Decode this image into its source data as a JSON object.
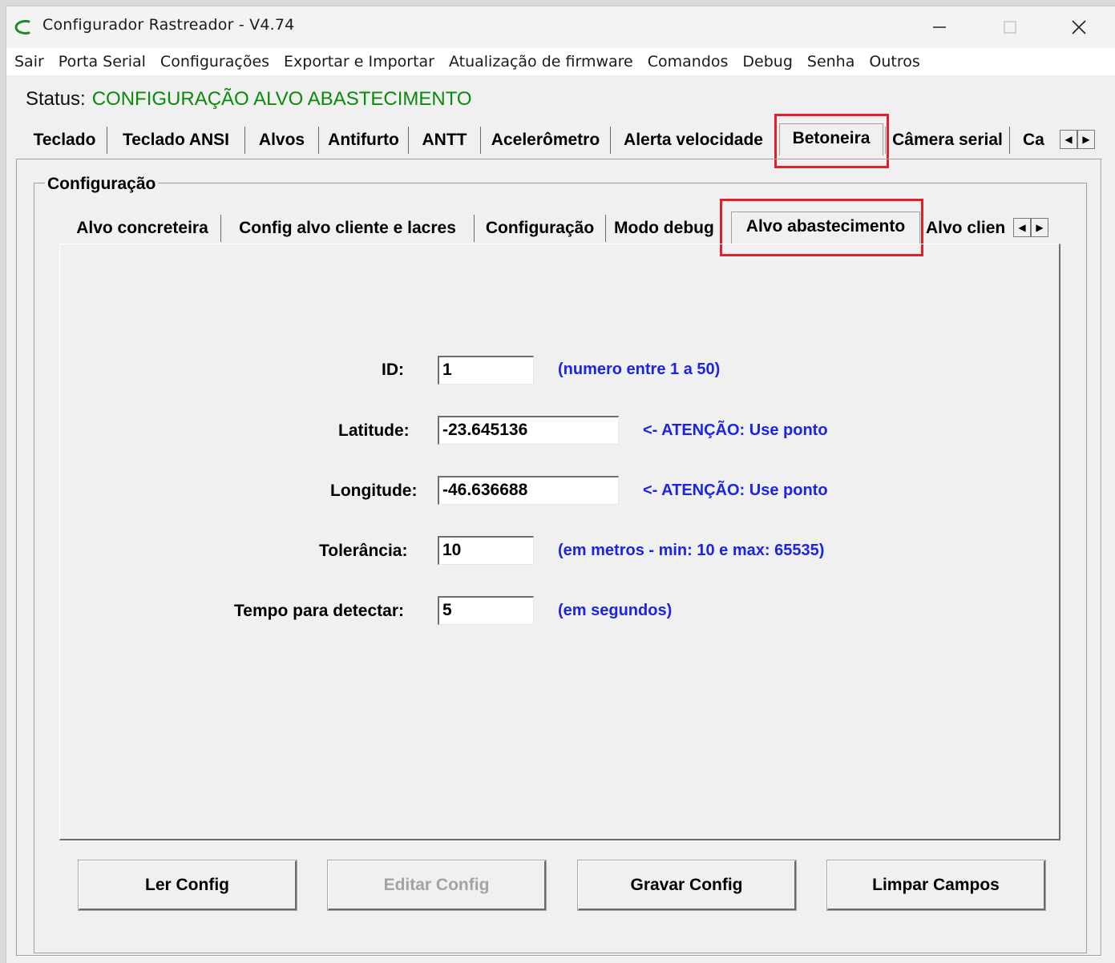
{
  "window": {
    "title": "Configurador Rastreador - V4.74"
  },
  "icons": {
    "app": "app-logo-icon",
    "minimize": "minimize-icon",
    "maximize": "maximize-icon",
    "close": "close-icon",
    "scroll_left": "chevron-left-icon",
    "scroll_right": "chevron-right-icon"
  },
  "menu": [
    "Sair",
    "Porta Serial",
    "Configurações",
    "Exportar e Importar",
    "Atualização de firmware",
    "Comandos",
    "Debug",
    "Senha",
    "Outros"
  ],
  "status": {
    "label": "Status:",
    "value": "CONFIGURAÇÃO ALVO ABASTECIMENTO",
    "color": "#0a8a0a"
  },
  "main_tabs": [
    "Teclado",
    "Teclado ANSI",
    "Alvos",
    "Antifurto",
    "ANTT",
    "Acelerômetro",
    "Alerta velocidade",
    "Betoneira",
    "Câmera serial",
    "Ca"
  ],
  "main_tabs_active": "Betoneira",
  "group": {
    "title": "Configuração"
  },
  "sub_tabs": [
    "Alvo concreteira",
    "Config alvo cliente e lacres",
    "Configuração",
    "Modo debug",
    "Alvo abastecimento",
    "Alvo clien"
  ],
  "sub_tabs_active": "Alvo abastecimento",
  "form": {
    "id": {
      "label": "ID:",
      "value": "1",
      "hint": "(numero entre 1 a 50)"
    },
    "latitude": {
      "label": "Latitude:",
      "value": "-23.645136",
      "hint": "<- ATENÇÃO: Use ponto"
    },
    "longitude": {
      "label": "Longitude:",
      "value": "-46.636688",
      "hint": "<- ATENÇÃO: Use ponto"
    },
    "tolerancia": {
      "label": "Tolerância:",
      "value": "10",
      "hint": "(em metros - min: 10 e max: 65535)"
    },
    "tempo": {
      "label": "Tempo para detectar:",
      "value": "5",
      "hint": "(em segundos)"
    }
  },
  "buttons": {
    "ler": "Ler Config",
    "editar": "Editar Config",
    "gravar": "Gravar Config",
    "limpar": "Limpar Campos"
  },
  "colors": {
    "hint_blue": "#1b24e6",
    "highlight_red": "#e0202a"
  }
}
